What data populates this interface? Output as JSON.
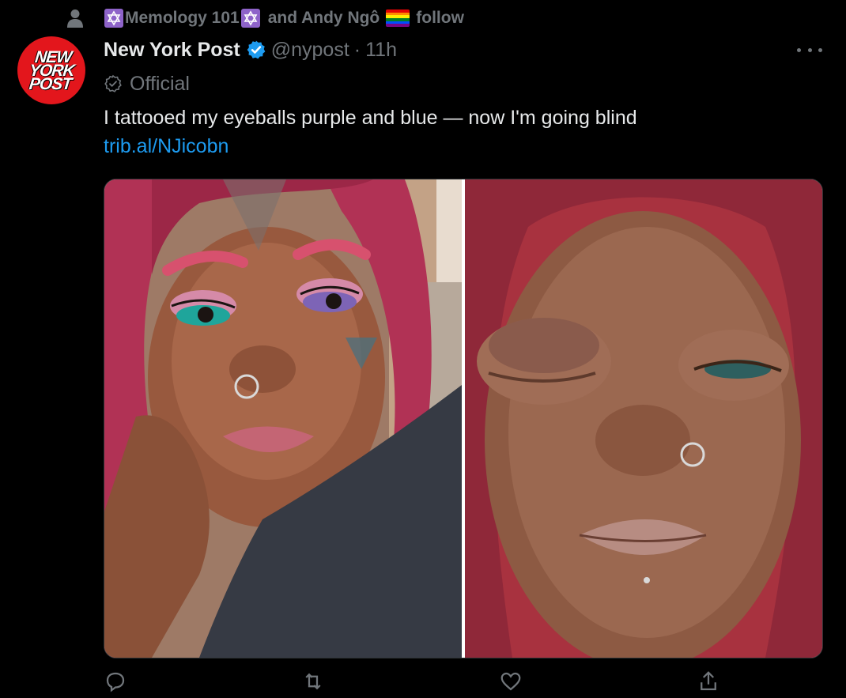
{
  "social_context": {
    "account_1": "Memology 101",
    "joiner": "and Andy Ngô",
    "action": "follow"
  },
  "tweet": {
    "avatar_logo_lines": [
      "NEW",
      "YORK",
      "POST"
    ],
    "display_name": "New York Post",
    "handle": "@nypost",
    "separator": "·",
    "time": "11h",
    "label": "Official",
    "text": "I tattooed my eyeballs purple and blue — now I'm going blind",
    "link": "trib.al/NJicobn"
  },
  "colors": {
    "background": "#000000",
    "primary_text": "#e7e9ea",
    "secondary_text": "#71767b",
    "link": "#1d9bf0",
    "verified": "#1d9bf0",
    "avatar_bg": "#e3161c"
  },
  "icons": {
    "person": "person-icon",
    "star_of_david": "star-of-david-icon",
    "pride_flag": "pride-flag-icon",
    "verified": "verified-badge-icon",
    "official": "official-badge-icon",
    "more": "more-options-icon",
    "reply": "reply-icon",
    "retweet": "retweet-icon",
    "like": "like-icon",
    "share": "share-icon"
  }
}
